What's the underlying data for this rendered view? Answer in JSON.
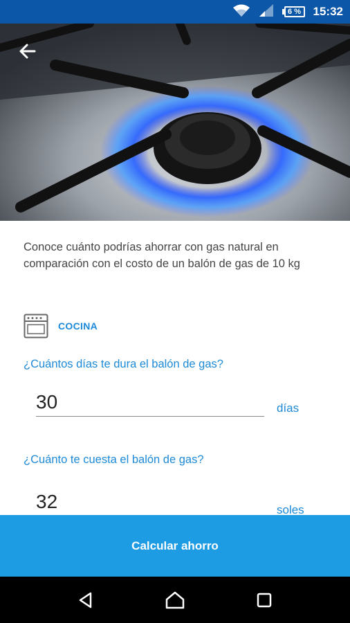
{
  "status_bar": {
    "time": "15:32",
    "battery_percent": "6 %",
    "icons": [
      "wifi-icon",
      "cell-signal-icon",
      "battery-icon"
    ]
  },
  "hero": {
    "image": "gas-stove-burner-flame",
    "back_icon": "back-arrow-icon"
  },
  "intro_text": "Conoce cuánto podrías ahorrar con gas natural en comparación con el costo de un balón de gas de 10 kg",
  "section": {
    "icon": "stove-icon",
    "label": "COCINA"
  },
  "questions": [
    {
      "label": "¿Cuántos días te dura el balón de gas?",
      "value": "30",
      "unit": "días"
    },
    {
      "label": "¿Cuánto te cuesta el balón de gas?",
      "value": "32",
      "unit": "soles"
    }
  ],
  "action": {
    "label": "Calcular ahorro"
  },
  "nav_bar": {
    "icons": [
      "back-triangle-icon",
      "home-icon",
      "recents-icon"
    ]
  },
  "colors": {
    "status_bar": "#0c57a8",
    "accent": "#1d8ad8",
    "button": "#1d9be3",
    "nav_bar": "#000000"
  }
}
